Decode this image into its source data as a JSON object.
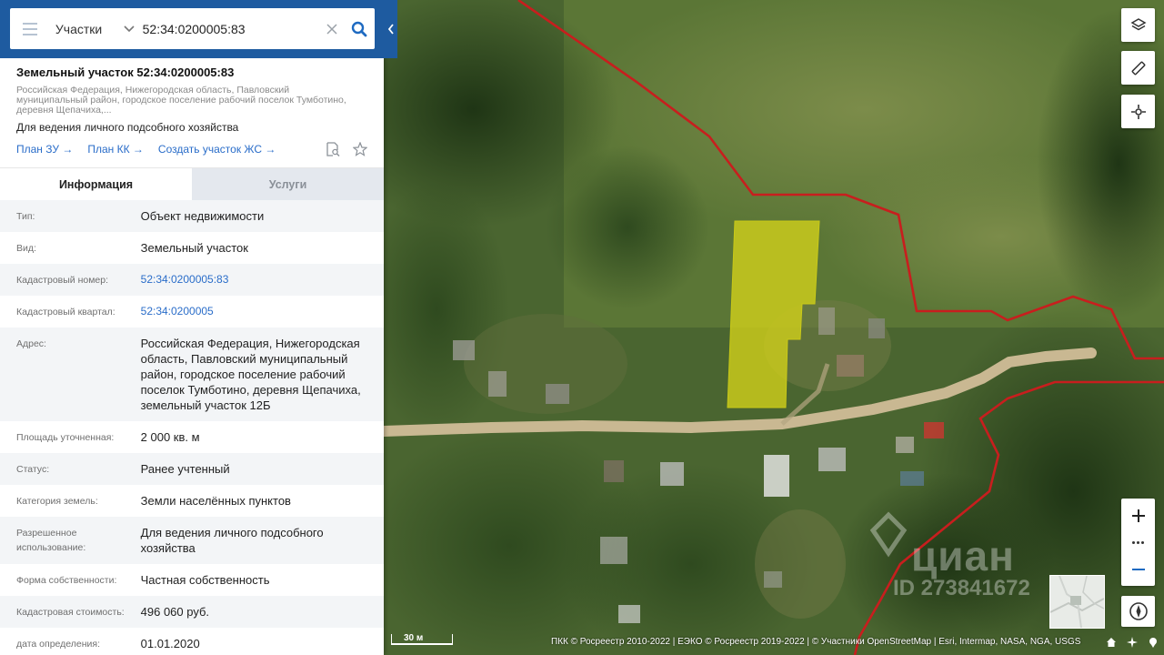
{
  "search": {
    "category": "Участки",
    "query": "52:34:0200005:83"
  },
  "object": {
    "title": "Земельный участок 52:34:0200005:83",
    "address_short": "Российская Федерация, Нижегородская область, Павловский муниципальный район, городское поселение рабочий поселок Тумботино, деревня Щепачиха,...",
    "purpose": "Для ведения личного подсобного хозяйства",
    "links": [
      "План ЗУ →",
      "План КК →",
      "Создать участок ЖС →"
    ]
  },
  "tabs": [
    "Информация",
    "Услуги"
  ],
  "info": [
    {
      "key": "Тип:",
      "value": "Объект недвижимости"
    },
    {
      "key": "Вид:",
      "value": "Земельный участок"
    },
    {
      "key": "Кадастровый номер:",
      "value": "52:34:0200005:83"
    },
    {
      "key": "Кадастровый квартал:",
      "value": "52:34:0200005"
    },
    {
      "key": "Адрес:",
      "value": "Российская Федерация, Нижегородская область, Павловский муниципальный район, городское поселение рабочий поселок Тумботино, деревня Щепачиха, земельный участок 12Б"
    },
    {
      "key": "Площадь уточненная:",
      "value": "2 000 кв. м"
    },
    {
      "key": "Статус:",
      "value": "Ранее учтенный"
    },
    {
      "key": "Категория земель:",
      "value": "Земли населённых пунктов"
    },
    {
      "key": "Разрешенное использование:",
      "value": "Для ведения личного подсобного хозяйства"
    },
    {
      "key": "Форма собственности:",
      "value": "Частная собственность"
    },
    {
      "key": "Кадастровая стоимость:",
      "value": "496 060 руб."
    },
    {
      "key": "дата определения:",
      "value": "01.01.2020"
    }
  ],
  "map": {
    "scale": "30 м",
    "attribution": "ПКК © Росреестр 2010-2022 | ЕЭКО © Росреестр 2019-2022 | © Участники OpenStreetMap | Esri, Intermap, NASA, NGA, USGS",
    "watermark_brand": "циан",
    "watermark_id": "ID 273841672",
    "colors": {
      "panel_header": "#1e5ba0",
      "link": "#2a6dc9",
      "parcel": "#d4d21a",
      "boundary": "#c81e1e"
    }
  }
}
